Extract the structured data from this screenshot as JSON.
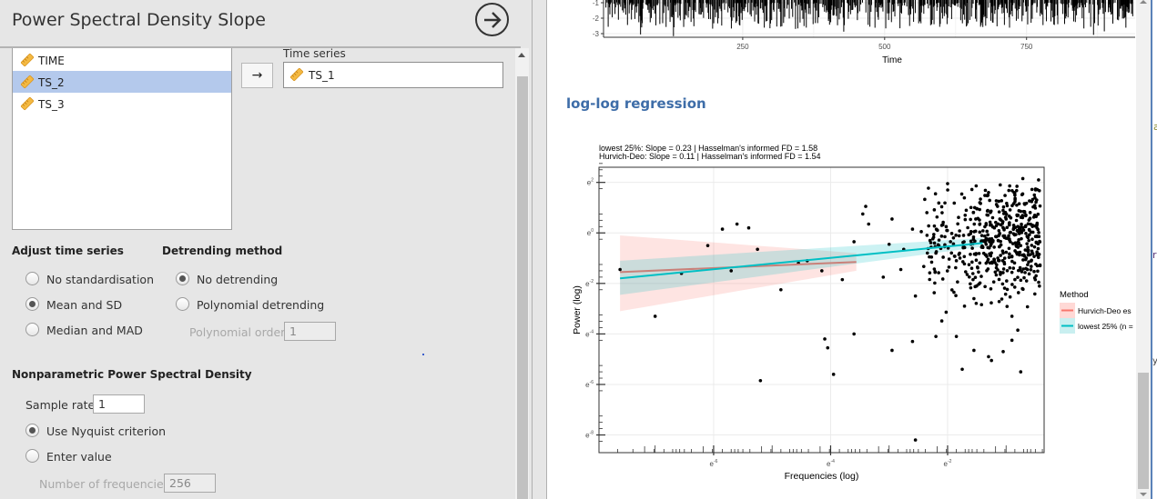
{
  "analysis": {
    "title": "Power Spectral Density Slope",
    "variables": [
      {
        "name": "TIME",
        "selected": false
      },
      {
        "name": "TS_2",
        "selected": true
      },
      {
        "name": "TS_3",
        "selected": false
      }
    ],
    "move_button": "→",
    "time_series_label": "Time series",
    "time_series_value": "TS_1",
    "adjust": {
      "heading": "Adjust time series",
      "options": [
        "No standardisation",
        "Mean and SD",
        "Median and MAD"
      ],
      "selected": "Mean and SD"
    },
    "detrend": {
      "heading": "Detrending method",
      "options": [
        "No detrending",
        "Polynomial detrending"
      ],
      "selected": "No detrending",
      "poly_order_label": "Polynomial order",
      "poly_order_value": "1"
    },
    "psd": {
      "heading": "Nonparametric Power Spectral Density",
      "sample_rate_label": "Sample rate",
      "sample_rate_value": "1",
      "options": [
        "Use Nyquist criterion",
        "Enter value"
      ],
      "selected": "Use Nyquist criterion",
      "nfreq_label": "Number of frequencies",
      "nfreq_value": "256"
    }
  },
  "results": {
    "section_heading": "log-log regression",
    "edge_fragments": [
      "a",
      "ri",
      "y'"
    ]
  },
  "chart_data": [
    {
      "type": "bar",
      "title": "",
      "xlabel": "Time",
      "ylabel": "",
      "x_ticks": [
        250,
        500,
        750
      ],
      "y_ticks": [
        -1,
        -2,
        -3
      ],
      "xlim": [
        0,
        940
      ],
      "ylim_visible": [
        -3.1,
        -0.9
      ],
      "note": "partially scrolled time-series spike plot; only lower part visible",
      "seed": 7,
      "n": 940
    },
    {
      "type": "scatter",
      "subtitle_lines": [
        "lowest 25%: Slope = 0.23 | Hasselman's informed FD = 1.58",
        "Hurvich-Deo: Slope = 0.11 | Hasselman's informed FD = 1.54"
      ],
      "xlabel": "Frequencies (log)",
      "ylabel": "Power (log)",
      "x_scale": "ln",
      "y_scale": "ln",
      "xlim": [
        -7.96,
        -0.35
      ],
      "ylim": [
        -8.7,
        2.6
      ],
      "x_ticks": [
        {
          "v": -6,
          "label": "e-6"
        },
        {
          "v": -4,
          "label": "e-4"
        },
        {
          "v": -2,
          "label": "e-2"
        }
      ],
      "y_ticks": [
        {
          "v": 2,
          "label": "e2"
        },
        {
          "v": 0,
          "label": "e0"
        },
        {
          "v": -2,
          "label": "e-2"
        },
        {
          "v": -4,
          "label": "e-4"
        },
        {
          "v": -6,
          "label": "e-6"
        },
        {
          "v": -8,
          "label": "e-8"
        }
      ],
      "grid": true,
      "legend": {
        "title": "Method",
        "position": "right",
        "entries": [
          {
            "label": "Hurvich-Deo es",
            "color": "#F8766D",
            "fill": "#FFD9D6"
          },
          {
            "label": "lowest 25% (n =",
            "color": "#00BFC4",
            "fill": "#C9EFF0"
          }
        ]
      },
      "fits": [
        {
          "name": "Hurvich-Deo",
          "slope": 0.11,
          "x": [
            -7.6,
            -3.56
          ],
          "y": [
            -1.55,
            -1.15
          ],
          "ci_lo": [
            -3.1,
            -1.5
          ],
          "ci_hi": [
            -0.1,
            -0.8
          ],
          "color": "#C98079",
          "ribbon": "#F8766D"
        },
        {
          "name": "lowest 25%",
          "slope": 0.23,
          "x": [
            -7.6,
            -1.4
          ],
          "y": [
            -1.8,
            -0.4
          ],
          "ci_lo": [
            -2.45,
            -0.55
          ],
          "ci_hi": [
            -1.1,
            -0.2
          ],
          "color": "#00BFC4",
          "ribbon": "#00BFC4"
        }
      ],
      "points_sample": [
        [
          -7.6,
          -1.45
        ],
        [
          -6.55,
          -1.6
        ],
        [
          -5.7,
          -1.5
        ],
        [
          -7.0,
          -3.3
        ],
        [
          -6.1,
          -0.5
        ],
        [
          -5.85,
          0.15
        ],
        [
          -5.6,
          0.35
        ],
        [
          -5.4,
          0.2
        ],
        [
          -5.25,
          -0.65
        ],
        [
          -4.85,
          -2.25
        ],
        [
          -4.55,
          -1.2
        ],
        [
          -4.4,
          -1.1
        ],
        [
          -4.15,
          -1.5
        ],
        [
          -3.8,
          -1.85
        ],
        [
          -3.6,
          -0.35
        ],
        [
          -3.45,
          0.75
        ],
        [
          -3.4,
          1.05
        ],
        [
          -3.35,
          0.35
        ],
        [
          -3.1,
          -1.75
        ],
        [
          -3.0,
          -0.45
        ],
        [
          -2.95,
          0.55
        ],
        [
          -2.8,
          -1.45
        ],
        [
          -2.75,
          -0.65
        ],
        [
          -2.6,
          0.15
        ],
        [
          -2.55,
          -2.5
        ],
        [
          -2.45,
          0.05
        ],
        [
          -2.3,
          -0.3
        ],
        [
          -2.2,
          -0.8
        ],
        [
          -2.1,
          0.3
        ],
        [
          -2.0,
          1.95
        ],
        [
          -1.9,
          -0.2
        ],
        [
          -1.85,
          -1.1
        ],
        [
          -1.7,
          0.7
        ],
        [
          -1.6,
          0.05
        ],
        [
          -1.55,
          -2.6
        ],
        [
          -1.45,
          1.2
        ],
        [
          -1.4,
          -0.55
        ],
        [
          -1.3,
          1.6
        ],
        [
          -1.2,
          0.2
        ],
        [
          -1.1,
          1.9
        ],
        [
          -1.05,
          -0.8
        ],
        [
          -1.0,
          0.55
        ],
        [
          -0.9,
          -3.3
        ],
        [
          -0.85,
          1.5
        ],
        [
          -0.75,
          -0.5
        ],
        [
          -0.7,
          0.85
        ],
        [
          -0.65,
          -1.9
        ],
        [
          -0.6,
          0.1
        ],
        [
          -5.2,
          -5.85
        ],
        [
          -4.1,
          -4.2
        ],
        [
          -4.05,
          -4.55
        ],
        [
          -3.95,
          -5.6
        ],
        [
          -3.6,
          -4.0
        ],
        [
          -2.95,
          -4.65
        ],
        [
          -2.55,
          -8.2
        ],
        [
          -2.6,
          -4.3
        ],
        [
          -2.2,
          -4.1
        ],
        [
          -1.85,
          -4.1
        ],
        [
          -1.75,
          -5.4
        ],
        [
          -1.55,
          -4.65
        ],
        [
          -1.3,
          -4.9
        ],
        [
          -1.25,
          -5.05
        ],
        [
          -1.05,
          -4.7
        ],
        [
          -0.9,
          -4.25
        ],
        [
          -0.75,
          -5.5
        ],
        [
          -0.8,
          -3.85
        ]
      ],
      "dense_cloud": {
        "x_range": [
          -2.6,
          -0.42
        ],
        "y_center": -0.4,
        "y_spread": 1.6,
        "count": 520,
        "seed": 11
      }
    }
  ]
}
